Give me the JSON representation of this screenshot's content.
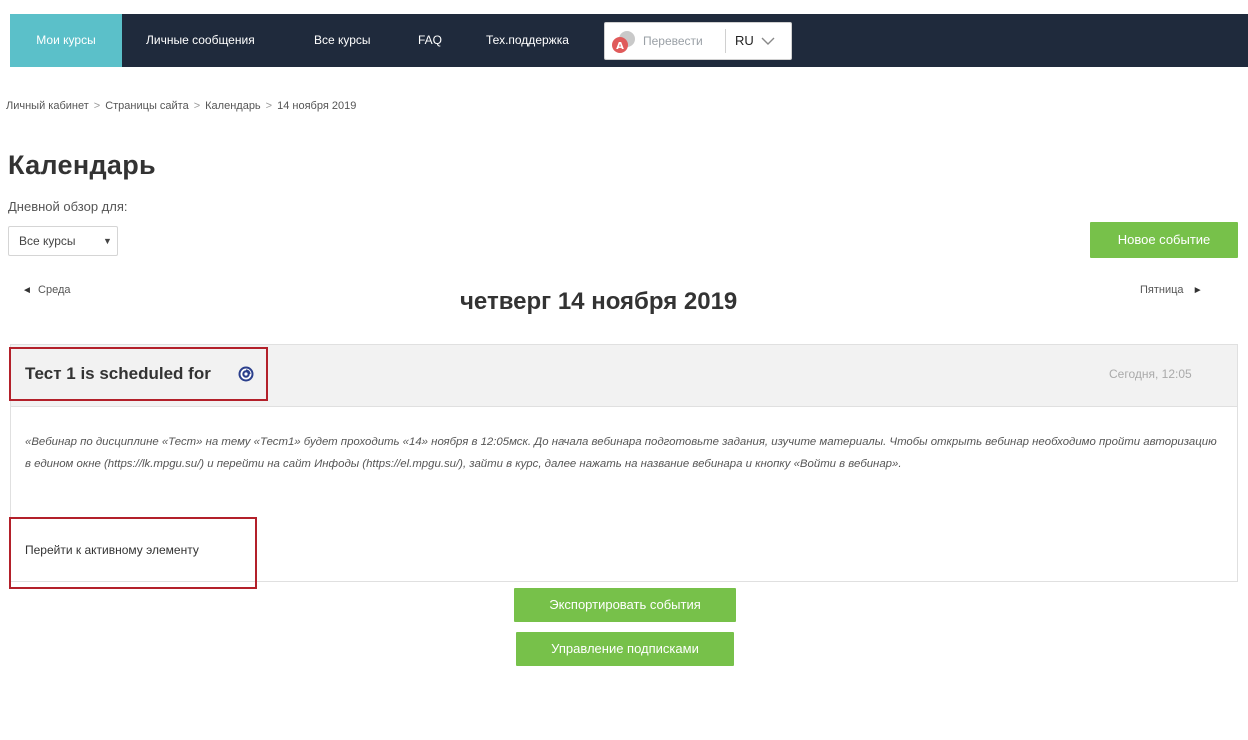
{
  "nav": {
    "items": [
      {
        "label": "Мои курсы"
      },
      {
        "label": "Личные сообщения"
      },
      {
        "label": "Все курсы"
      },
      {
        "label": "FAQ"
      },
      {
        "label": "Тех.поддержка"
      }
    ],
    "translate": {
      "label": "Перевести",
      "icon": "translate-icon"
    },
    "language": {
      "label": "RU",
      "icon": "chevron-down-icon"
    }
  },
  "breadcrumb": [
    "Личный кабинет",
    "Страницы сайта",
    "Календарь",
    "14 ноября 2019"
  ],
  "breadcrumb_separator": ">",
  "page": {
    "title": "Календарь",
    "day_view_label": "Дневной обзор для:",
    "course_filter": {
      "selected": "Все курсы",
      "caret": "▼"
    },
    "new_event_label": "Новое событие"
  },
  "day_nav": {
    "prev_label": "Среда",
    "next_label": "Пятница",
    "current": "четверг 14 ноября 2019",
    "prev_arrow": "◄",
    "next_arrow": "►"
  },
  "event": {
    "title": "Тест 1 is scheduled for",
    "icon": "quiz-icon",
    "time": "Сегодня, 12:05",
    "description": "«Вебинар по дисциплине «Тест» на тему «Тест1» будет проходить «14» ноября  в 12:05мск. До начала вебинара  подготовьте задания, изучите материалы. Чтобы открыть вебинар необходимо пройти авторизацию в едином окне (https://lk.mpgu.su/) и перейти на сайт Инфоды (https://el.mpgu.su/), зайти в курс, далее нажать на название вебинара и кнопку «Войти в вебинар».",
    "goto_label": "Перейти к активному элементу"
  },
  "actions": {
    "export_label": "Экспортировать события",
    "subscriptions_label": "Управление подписками"
  },
  "colors": {
    "nav_bg": "#1f2a3c",
    "nav_active": "#5bc0c9",
    "button_green": "#77c14a",
    "highlight_red": "#b3202a"
  }
}
